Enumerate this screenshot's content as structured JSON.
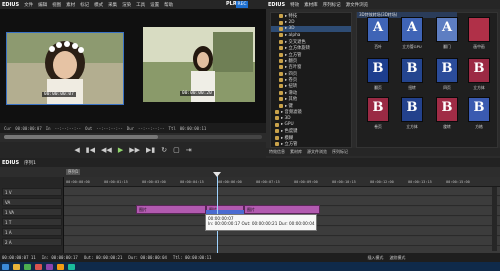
{
  "app": {
    "brand": "EDIUS",
    "player_mode": "PLR",
    "rec_mode": "REC"
  },
  "menu": [
    "文件",
    "编辑",
    "视图",
    "素材",
    "标记",
    "模式",
    "采集",
    "渲染",
    "工具",
    "设置",
    "帮助"
  ],
  "player": {
    "left_timecode": "00:00:00:07",
    "right_timecode": "00:00:00:20",
    "tc_in_label": "Cur",
    "tc_in": "00:00:00:07",
    "tc_in2_label": "In",
    "tc_in2": "--:--:--:--",
    "tc_out_label": "Out",
    "tc_out": "--:--:--:--",
    "tc_dur_label": "Dur",
    "tc_dur": "--:--:--:--",
    "ttl_label": "Ttl",
    "ttl": "00:00:00:11"
  },
  "transport": [
    "◀",
    "▮◀",
    "◀◀",
    "▶",
    "▶▶",
    "▶▮",
    "↻",
    "▢",
    "⇥"
  ],
  "right_panel": {
    "title": "EDIUS",
    "tabs": [
      "特效",
      "素材库",
      "序列标记",
      "源文件浏览"
    ],
    "breadcrumb": "3D特效转场(3D转场)",
    "tree": [
      "▸ 特技",
      "▸ 2D",
      "▸ 3D",
      "▸ alpha",
      "▸ 交叉退色",
      "▸ 立方体旋转",
      "▸ 立方管",
      "▸ 翻页",
      "▸ 百叶窗",
      "▸ 四页",
      "▸ 卷页",
      "▸ 扭转",
      "▸ 滑动",
      "▸ 其他",
      "▸ 键",
      "▸ 音频滤镜",
      "▸ 3D",
      "▸ GPU",
      "▸ 色度键",
      "▸ 模糊",
      "▸ 立方管",
      "▸ 拆分",
      "▸ 全部"
    ],
    "thumb_labels": [
      "百叶",
      "立方管GPU",
      "翻门",
      "画中画",
      "翻页",
      "扭转",
      "四页",
      "立方体",
      "卷页",
      "立方体",
      "旋转",
      "方格"
    ],
    "footer": [
      "特效信息",
      "素材库",
      "源文件浏览",
      "序列标记"
    ]
  },
  "timeline": {
    "title": "EDIUS",
    "sequence": "序列1",
    "tracks": [
      "1 V",
      "VA",
      "1 VA",
      "1 T",
      "1 A",
      "2 A"
    ],
    "ruler": [
      "00:00:00:00",
      "00:00:01:15",
      "00:00:03:00",
      "00:00:04:15",
      "00:00:06:00",
      "00:00:07:15",
      "00:00:09:00",
      "00:00:10:15",
      "00:00:12:00",
      "00:00:13:15",
      "00:00:15:00"
    ],
    "clips": [
      "图片",
      "图片",
      "图片"
    ],
    "tooltip_line1": "00:00:00:07",
    "tooltip_line2": "In: 00:00:00:17  Out: 00:00:00:21  Dur: 00:00:00:04"
  },
  "statusbar": {
    "a": "00:00:00:07 11",
    "b": "In: 00:00:00:17",
    "c": "Out: 00:00:00:21",
    "d": "Dur: 00:00:00:04",
    "e": "Ttl: 00:00:00:11",
    "right1": "插入模式",
    "right2": "波纹模式"
  },
  "colors": {
    "accent": "#1d6fd0",
    "clip": "#b25ab0",
    "playhead": "#9ed3ff"
  }
}
